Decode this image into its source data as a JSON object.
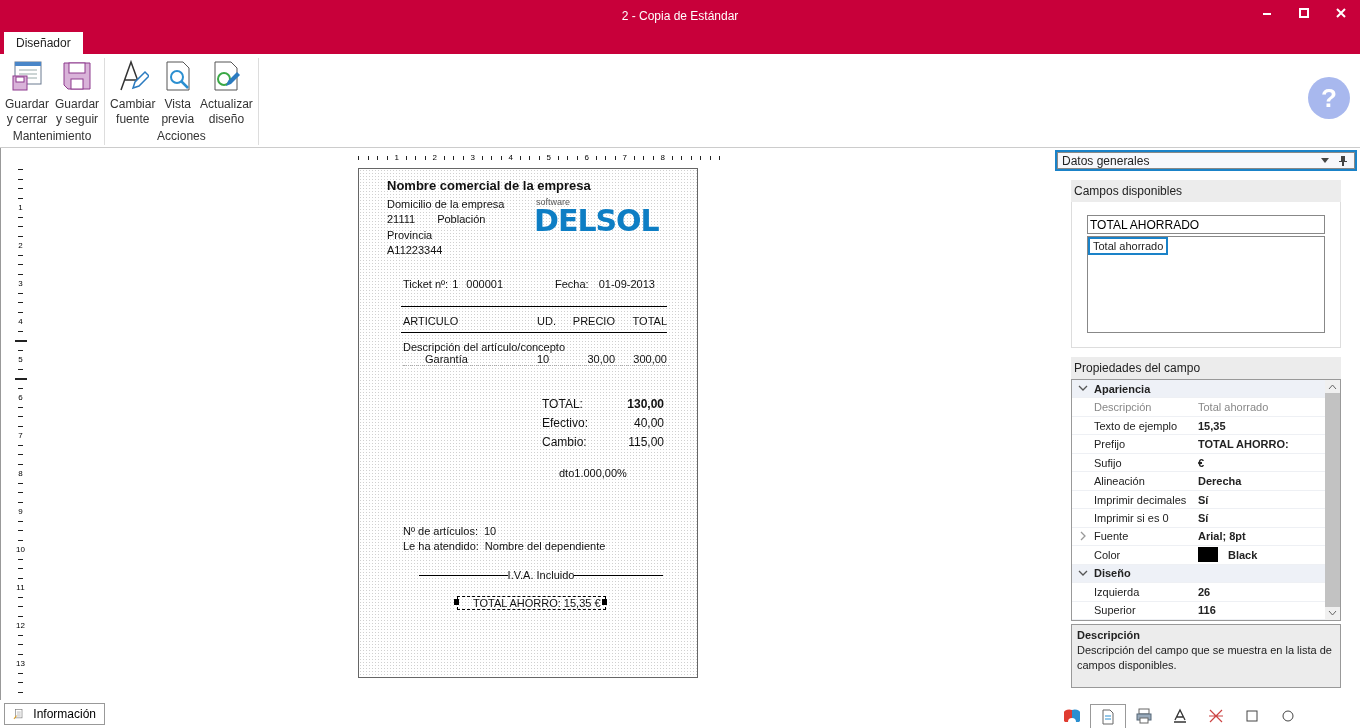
{
  "window": {
    "title": "2 - Copia de Estándar"
  },
  "tabs": [
    {
      "label": "Diseñador",
      "selected": true
    }
  ],
  "ribbon": {
    "groups": [
      {
        "label": "Mantenimiento",
        "buttons": [
          {
            "lines": [
              "Guardar",
              "y cerrar"
            ]
          },
          {
            "lines": [
              "Guardar",
              "y seguir"
            ]
          }
        ]
      },
      {
        "label": "Acciones",
        "buttons": [
          {
            "lines": [
              "Cambiar",
              "fuente"
            ]
          },
          {
            "lines": [
              "Vista",
              "previa"
            ]
          },
          {
            "lines": [
              "Actualizar",
              "diseño"
            ]
          }
        ]
      }
    ]
  },
  "help": "?",
  "rulers": {
    "horizontal": [
      "1",
      "2",
      "3",
      "4",
      "5",
      "6",
      "7",
      "8"
    ],
    "vertical": [
      "1",
      "2",
      "3",
      "4",
      "5",
      "6",
      "7",
      "8",
      "9",
      "10",
      "11",
      "12",
      "13"
    ]
  },
  "report": {
    "company": "Nombre  comercial de la empresa",
    "address": "Domicilio de la empresa",
    "postal_code": "21111",
    "city": "Población",
    "province": "Provincia",
    "tax_id": "A11223344",
    "logo": {
      "small": "software",
      "main": "DELSOL"
    },
    "ticket": {
      "label": "Ticket nº:",
      "series": "1",
      "number": "000001",
      "date_label": "Fecha:",
      "date": "01-09-2013"
    },
    "columns": [
      "ARTICULO",
      "UD.",
      "PRECIO",
      "TOTAL"
    ],
    "item_heading": "Descripción del artículo/concepto",
    "item": {
      "name": "Garantía",
      "units": "10",
      "price": "30,00",
      "total": "300,00"
    },
    "totals": [
      {
        "label": "TOTAL:",
        "value": "130,00",
        "kind": "grand"
      },
      {
        "label": "Efectivo:",
        "value": "40,00",
        "kind": "line"
      },
      {
        "label": "Cambio:",
        "value": "115,00",
        "kind": "line"
      }
    ],
    "discount": "dto1.000,00%",
    "count_label": "Nº de artículos:",
    "count": "10",
    "attendant_label": "Le ha atendido:",
    "attendant": "Nombre del dependiente",
    "tax_note": "I.V.A. Incluido",
    "field": {
      "text": "TOTAL AHORRO: 15,35 €",
      "selected": true
    }
  },
  "section_dropdown": "Datos generales",
  "available_fields": {
    "title": "Campos disponibles",
    "search": "TOTAL AHORRADO",
    "items": [
      {
        "label": "Total ahorrado",
        "selected": true
      }
    ]
  },
  "properties": {
    "title": "Propiedades del campo",
    "rows": [
      {
        "kind": "category",
        "label": "Apariencia",
        "expanded": true
      },
      {
        "kind": "property",
        "name": "Descripción",
        "value": "Total ahorrado",
        "selected": true
      },
      {
        "kind": "property",
        "name": "Texto de ejemplo",
        "value": "15,35",
        "selected": false
      },
      {
        "kind": "property",
        "name": "Prefijo",
        "value": "TOTAL AHORRO:",
        "selected": false
      },
      {
        "kind": "property",
        "name": "Sufijo",
        "value": "€",
        "selected": false
      },
      {
        "kind": "property",
        "name": "Alineación",
        "value": "Derecha",
        "selected": false
      },
      {
        "kind": "property",
        "name": "Imprimir decimales",
        "value": "Sí",
        "selected": false
      },
      {
        "kind": "property",
        "name": "Imprimir si es 0",
        "value": "Sí",
        "selected": false
      },
      {
        "kind": "group",
        "name": "Fuente",
        "value": "Arial; 8pt",
        "expanded": false
      },
      {
        "kind": "color",
        "name": "Color",
        "value": "Black",
        "color": "#000000"
      },
      {
        "kind": "category",
        "label": "Diseño",
        "expanded": true
      },
      {
        "kind": "property",
        "name": "Izquierda",
        "value": "26",
        "selected": false
      },
      {
        "kind": "property",
        "name": "Superior",
        "value": "116",
        "selected": false
      }
    ]
  },
  "description": {
    "title": "Descripción",
    "text": "Descripción del campo que se muestra en la lista de campos disponibles."
  },
  "info_button": "Información",
  "panel_tabs": [
    {
      "selected": false
    },
    {
      "selected": true
    },
    {
      "selected": false
    },
    {
      "selected": false
    },
    {
      "selected": false
    },
    {
      "selected": false
    },
    {
      "selected": false
    }
  ]
}
